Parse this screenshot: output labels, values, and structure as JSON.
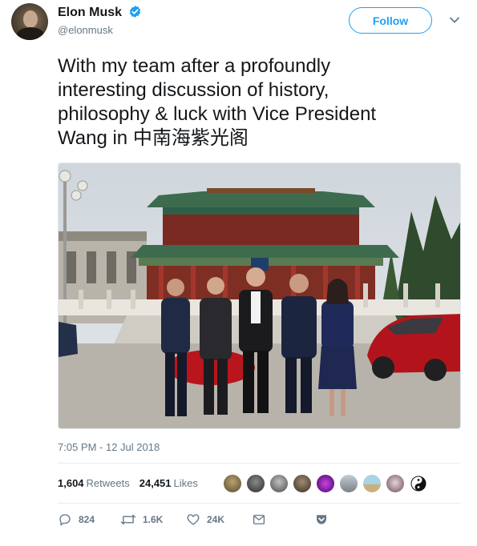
{
  "author": {
    "display_name": "Elon Musk",
    "handle": "@elonmusk",
    "verified": true,
    "follow_label": "Follow"
  },
  "tweet": {
    "text": "With my team after a profoundly\ninteresting discussion of history,\nphilosophy & luck with Vice President\nWang in 中南海紫光阁",
    "timestamp": "7:05 PM - 12 Jul 2018"
  },
  "stats": {
    "retweets_count": "1,604",
    "retweets_label": "Retweets",
    "likes_count": "24,451",
    "likes_label": "Likes",
    "liker_avatars": [
      "avatar-1",
      "avatar-2",
      "avatar-3",
      "avatar-4",
      "avatar-5",
      "avatar-6",
      "avatar-7",
      "avatar-8",
      "yin-yang-avatar"
    ]
  },
  "actions": {
    "reply_count": "824",
    "retweet_count": "1.6K",
    "like_count": "24K"
  },
  "colors": {
    "accent": "#1da1f2",
    "secondary_text": "#657786",
    "primary_text": "#14171a"
  }
}
